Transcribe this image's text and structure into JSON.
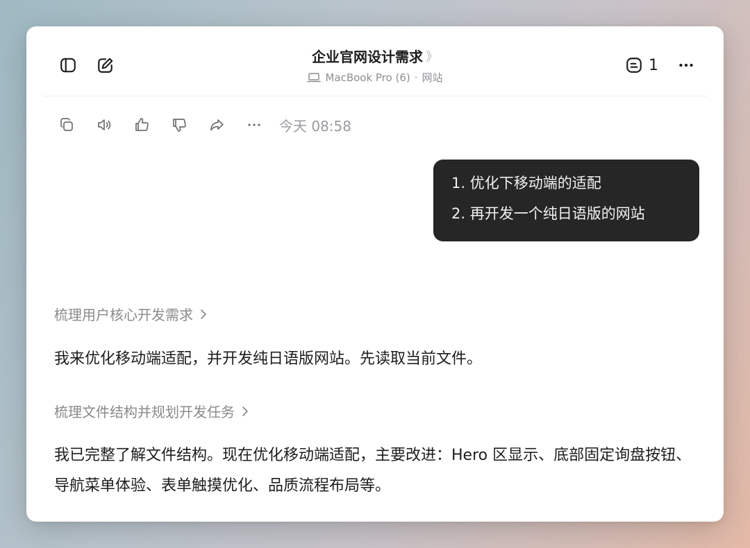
{
  "header": {
    "title": "企业官网设计需求",
    "title_chevron": "》",
    "device": "MacBook Pro (6)",
    "separator": "·",
    "workspace": "网站",
    "count": "1"
  },
  "icons": {
    "sidebar": "sidebar-toggle-icon",
    "compose": "compose-icon",
    "laptop": "laptop-icon",
    "notes": "notes-icon",
    "more": "more-horizontal-icon",
    "copy": "copy-icon",
    "speaker": "speaker-icon",
    "like": "thumbs-up-icon",
    "dislike": "thumbs-down-icon",
    "share": "share-icon"
  },
  "message_actions": {
    "timestamp": "今天 08:58"
  },
  "user_message": {
    "lines": [
      "1. 优化下移动端的适配",
      "2. 再开发一个纯日语版的网站"
    ]
  },
  "assistant": {
    "step1": "梳理用户核心开发需求",
    "para1": "我来优化移动端适配，并开发纯日语版网站。先读取当前文件。",
    "step2": "梳理文件结构并规划开发任务",
    "para2": "我已完整了解文件结构。现在优化移动端适配，主要改进：Hero 区显示、底部固定询盘按钮、导航菜单体验、表单触摸优化、品质流程布局等。"
  },
  "colors": {
    "bubble_bg": "#262626",
    "text": "#1d1d1f",
    "muted": "#8a8a8e"
  }
}
